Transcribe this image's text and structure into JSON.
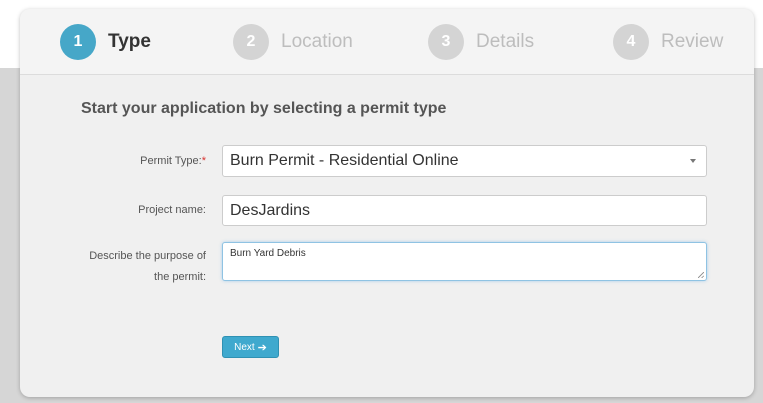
{
  "steps": [
    {
      "number": "1",
      "label": "Type",
      "state": "active"
    },
    {
      "number": "2",
      "label": "Location",
      "state": "inactive"
    },
    {
      "number": "3",
      "label": "Details",
      "state": "inactive"
    },
    {
      "number": "4",
      "label": "Review",
      "state": "inactive"
    }
  ],
  "form": {
    "heading": "Start your application by selecting a permit type",
    "permit_type": {
      "label": "Permit Type:",
      "required_marker": "*",
      "selected_value": "Burn Permit - Residential Online"
    },
    "project_name": {
      "label": "Project name:",
      "value": "DesJardins"
    },
    "purpose": {
      "label_line1": "Describe the purpose of",
      "label_line2": "the permit:",
      "value": "Burn Yard Debris"
    },
    "next_button": {
      "label": "Next",
      "icon": "arrow-right-icon"
    }
  },
  "colors": {
    "active_step": "#46a7c8",
    "inactive_step": "#d4d4d4",
    "primary_button": "#3fa9ce",
    "required": "#d9322f"
  }
}
